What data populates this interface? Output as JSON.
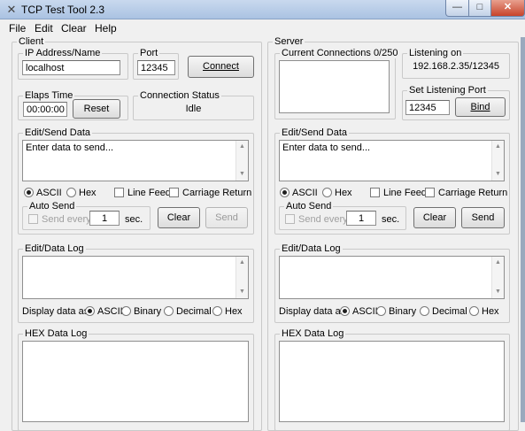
{
  "window": {
    "title": "TCP Test Tool 2.3",
    "minimize": "—",
    "maximize": "□",
    "close": "✕"
  },
  "menu": [
    "File",
    "Edit",
    "Clear",
    "Help"
  ],
  "client": {
    "title": "Client",
    "ip_label": "IP Address/Name",
    "ip_value": "localhost",
    "port_label": "Port",
    "port_value": "12345",
    "connect_label": "Connect",
    "elapsed_label": "Elaps Time",
    "elapsed_value": "00:00:00",
    "reset_label": "Reset",
    "status_label": "Connection Status",
    "status_value": "Idle",
    "send": {
      "title": "Edit/Send Data",
      "text": "Enter data to send...",
      "ascii": "ASCII",
      "hex": "Hex",
      "line_feed": "Line Feed",
      "carriage_return": "Carriage Return",
      "auto_send": "Auto Send",
      "send_every": "Send every",
      "interval": "1",
      "sec": "sec.",
      "clear": "Clear",
      "send": "Send"
    },
    "log": {
      "title": "Edit/Data Log",
      "display_as": "Display data as:",
      "ascii": "ASCII",
      "binary": "Binary",
      "decimal": "Decimal",
      "hex": "Hex"
    },
    "hexlog": {
      "title": "HEX Data Log"
    }
  },
  "server": {
    "title": "Server",
    "connections_label": "Current Connections 0/250",
    "listening_label": "Listening on",
    "listening_value": "192.168.2.35/12345",
    "set_port_label": "Set Listening Port",
    "set_port_value": "12345",
    "bind_label": "Bind",
    "send": {
      "title": "Edit/Send Data",
      "text": "Enter data to send...",
      "ascii": "ASCII",
      "hex": "Hex",
      "line_feed": "Line Feed",
      "carriage_return": "Carriage Return",
      "auto_send": "Auto Send",
      "send_every": "Send every",
      "interval": "1",
      "sec": "sec.",
      "clear": "Clear",
      "send": "Send"
    },
    "log": {
      "title": "Edit/Data Log",
      "display_as": "Display data as:",
      "ascii": "ASCII",
      "binary": "Binary",
      "decimal": "Decimal",
      "hex": "Hex"
    },
    "hexlog": {
      "title": "HEX Data Log"
    }
  },
  "icons": {
    "app": "network-plug-icon",
    "scroll_up": "triangle-up-icon",
    "scroll_down": "triangle-down-icon"
  }
}
